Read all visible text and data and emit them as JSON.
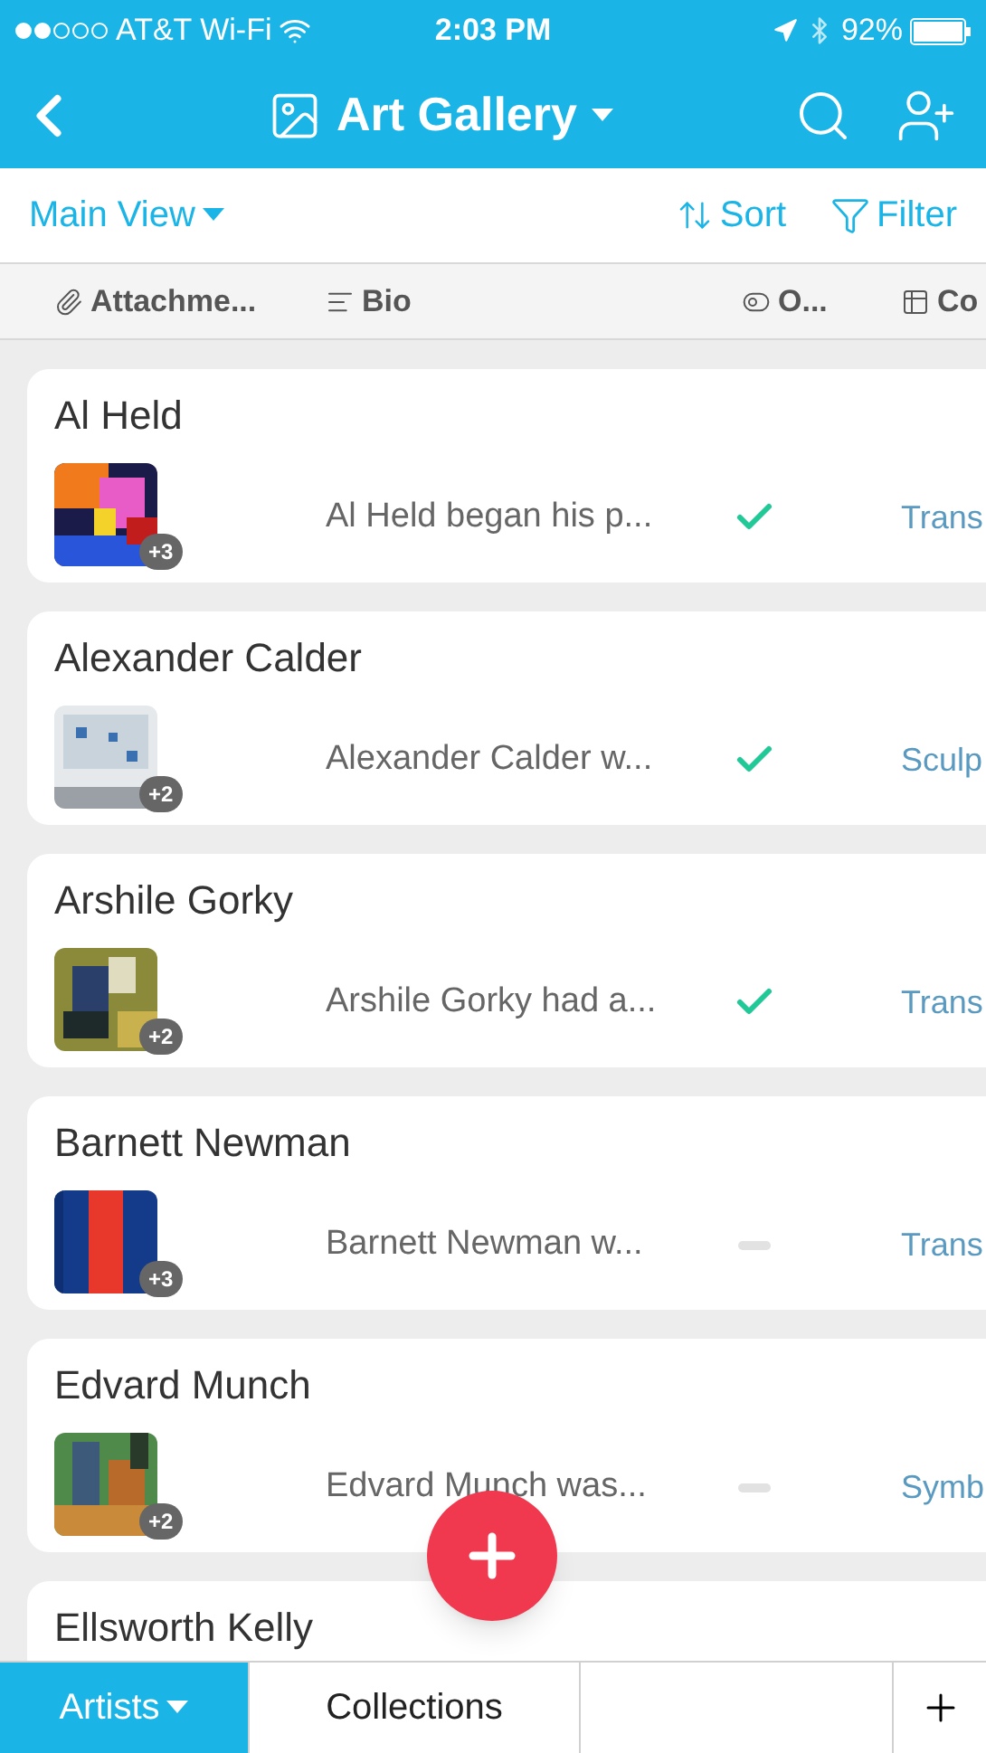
{
  "status_bar": {
    "carrier": "AT&T Wi-Fi",
    "time": "2:03 PM",
    "battery": "92%"
  },
  "nav": {
    "title": "Art Gallery"
  },
  "toolbar": {
    "view": "Main View",
    "sort": "Sort",
    "filter": "Filter"
  },
  "columns": [
    {
      "kind": "attachment",
      "label": "Attachme..."
    },
    {
      "kind": "text",
      "label": "Bio"
    },
    {
      "kind": "toggle",
      "label": "O..."
    },
    {
      "kind": "link",
      "label": "Co"
    }
  ],
  "records": [
    {
      "name": "Al Held",
      "badge": "+3",
      "bio": "Al Held began his p...",
      "checked": true,
      "column_4": "Trans"
    },
    {
      "name": "Alexander Calder",
      "badge": "+2",
      "bio": "Alexander Calder w...",
      "checked": true,
      "column_4": "Sculp"
    },
    {
      "name": "Arshile Gorky",
      "badge": "+2",
      "bio": "Arshile Gorky had a...",
      "checked": true,
      "column_4": "Trans"
    },
    {
      "name": "Barnett Newman",
      "badge": "+3",
      "bio": "Barnett Newman w...",
      "checked": false,
      "column_4": "Trans"
    },
    {
      "name": "Edvard Munch",
      "badge": "+2",
      "bio": "Edvard Munch was...",
      "checked": false,
      "column_4": "Symb"
    },
    {
      "name": "Ellsworth Kelly"
    }
  ],
  "tabs": [
    {
      "label": "Artists",
      "selected": true
    },
    {
      "label": "Collections",
      "selected": false
    }
  ]
}
